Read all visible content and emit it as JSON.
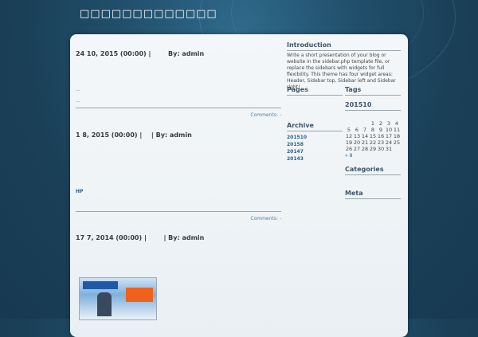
{
  "site": {
    "title": "□□□□□□□□□□□□□"
  },
  "posts": [
    {
      "date": "24 10, 2015 (00:00)",
      "sep": "|",
      "author": "By: admin",
      "lines": [
        "...",
        "..."
      ],
      "comments": "Comments: -"
    },
    {
      "date": "1 8, 2015 (00:00)",
      "sep": "|",
      "sep2": "|",
      "author": "By: admin",
      "body_link": "HP",
      "comments": "Comments: -"
    },
    {
      "date": "17 7, 2014 (00:00)",
      "sep": "|",
      "author": "By: admin"
    }
  ],
  "sidebar": {
    "introduction": {
      "title": "Introduction",
      "text": "Write a short presentation of your blog or website in the sidebar.php template file, or replace the sidebars with widgets for full flexibility. This theme has four widget areas: Header, Sidebar top, Sidebar left and Sidebar right!"
    },
    "pages": {
      "title": "Pages"
    },
    "archive": {
      "title": "Archive",
      "items": [
        "201510",
        "20158",
        "20147",
        "20143"
      ]
    },
    "tags": {
      "title": "Tags"
    },
    "calendar": {
      "caption": "201510",
      "rows": [
        [
          "",
          "",
          "",
          "1",
          "2",
          "3",
          "4"
        ],
        [
          "5",
          "6",
          "7",
          "8",
          "9",
          "10",
          "11"
        ],
        [
          "12",
          "13",
          "14",
          "15",
          "16",
          "17",
          "18"
        ],
        [
          "19",
          "20",
          "21",
          "22",
          "23",
          "24",
          "25"
        ],
        [
          "26",
          "27",
          "28",
          "29",
          "30",
          "31",
          ""
        ]
      ],
      "prev": "« 8"
    },
    "categories": {
      "title": "Categories"
    },
    "meta": {
      "title": "Meta"
    }
  },
  "colors": {
    "background": "#1f4a66",
    "panel": "#f1f5f8",
    "link": "#2a5f8c"
  }
}
